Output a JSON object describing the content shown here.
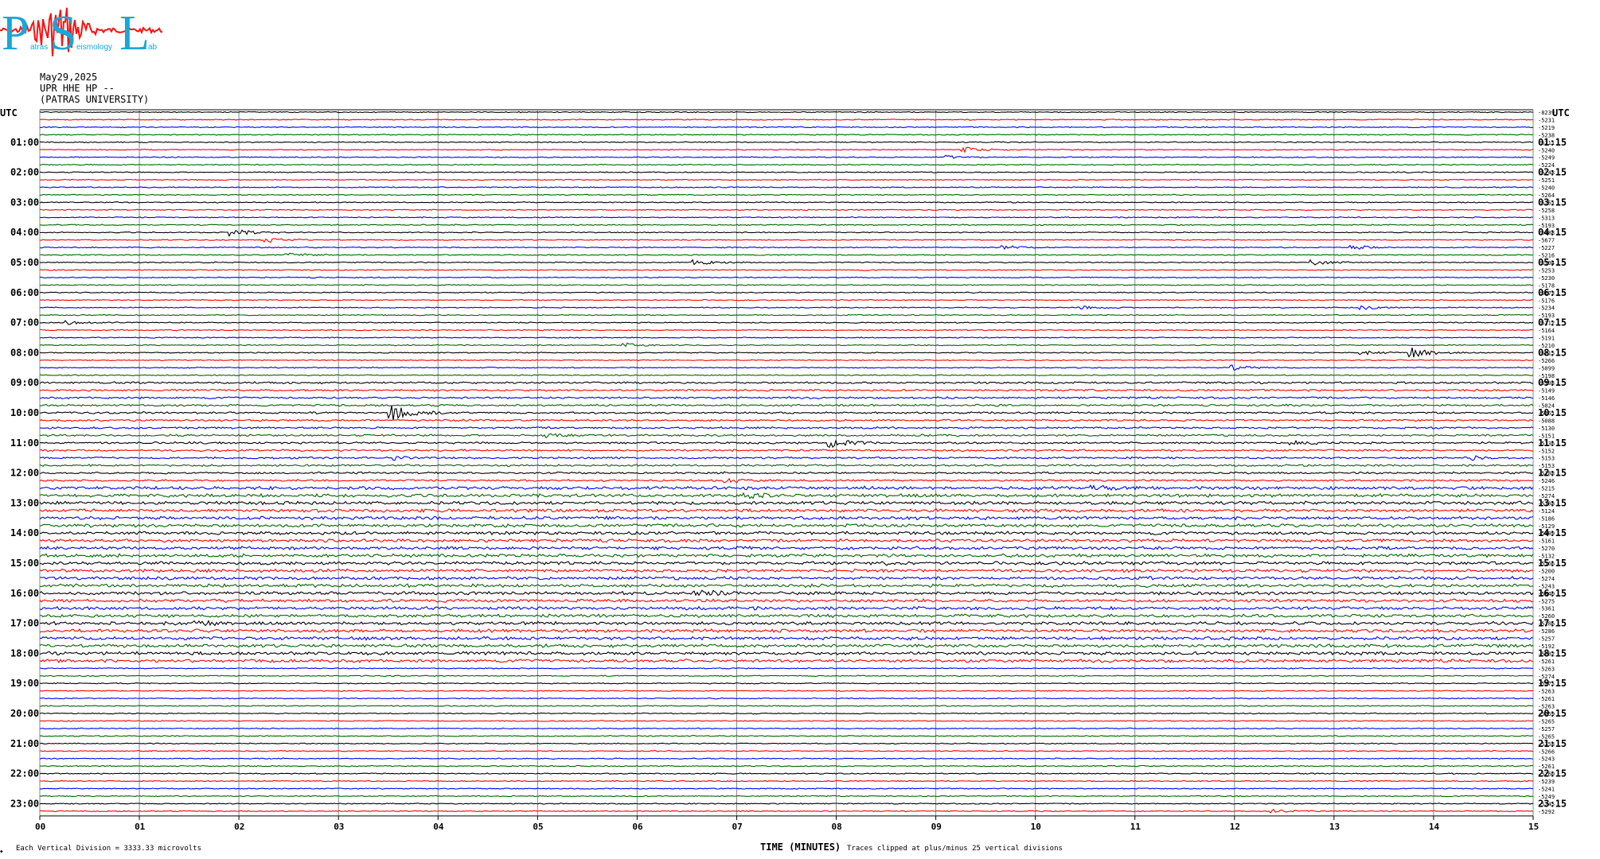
{
  "logo": {
    "letters": [
      "P",
      "S",
      "L"
    ],
    "words": [
      "atras",
      "eismology",
      "ab"
    ],
    "colors": {
      "letters": "#19a6d8",
      "wave": "#ff1010"
    }
  },
  "header": {
    "date": "May29,2025",
    "channel": "UPR HHE HP --",
    "institution": "(PATRAS UNIVERSITY)"
  },
  "footer": {
    "division_note": "Each Vertical Division = 3333.33 microvolts",
    "xlabel": "TIME (MINUTES)",
    "clip_note": "Traces clipped at plus/minus 25 vertical divisions",
    "corner_mark": "◆"
  },
  "chart_data": {
    "type": "line",
    "title": "",
    "xlabel": "TIME (MINUTES)",
    "ylabel": "",
    "xlim": [
      0,
      15
    ],
    "x_ticks": [
      "00",
      "01",
      "02",
      "03",
      "04",
      "05",
      "06",
      "07",
      "08",
      "09",
      "10",
      "11",
      "12",
      "13",
      "14",
      "15"
    ],
    "grid": "vertical lines at each minute",
    "trace_colors": [
      "#000000",
      "#ff0000",
      "#0000ff",
      "#006400"
    ],
    "left_axis_title": "UTC",
    "right_axis_title": "UTC",
    "left_hour_labels": [
      "01:00",
      "02:00",
      "03:00",
      "04:00",
      "05:00",
      "06:00",
      "07:00",
      "08:00",
      "09:00",
      "10:00",
      "11:00",
      "12:00",
      "13:00",
      "14:00",
      "15:00",
      "16:00",
      "17:00",
      "18:00",
      "19:00",
      "20:00",
      "21:00",
      "22:00",
      "23:00"
    ],
    "right_hour_labels": [
      "01:15",
      "02:15",
      "03:15",
      "04:15",
      "05:15",
      "06:15",
      "07:15",
      "08:15",
      "09:15",
      "10:15",
      "11:15",
      "12:15",
      "13:15",
      "14:15",
      "15:15",
      "16:15",
      "17:15",
      "18:15",
      "19:15",
      "20:15",
      "21:15",
      "22:15",
      "23:15"
    ],
    "trace_means": [
      "-8239",
      "-5231",
      "-5219",
      "-5238",
      "-5211",
      "-5240",
      "-5249",
      "-5224",
      "-5248",
      "-5251",
      "-5240",
      "-5264",
      "-5251",
      "-5258",
      "-5313",
      "-5193",
      "-5188",
      "-5677",
      "-5227",
      "-5216",
      "-5194",
      "-5253",
      "-5230",
      "-5178",
      "-5173",
      "-5176",
      "-5234",
      "-5193",
      "-5212",
      "-5164",
      "-5191",
      "-5210",
      "-5215",
      "-5266",
      "-5099",
      "-5198",
      "-5198",
      "-5149",
      "-5146",
      "-5024",
      "-5161",
      "-5088",
      "-5130",
      "-5151",
      "-5136",
      "-5152",
      "-5153",
      "-5153",
      "-5188",
      "-5246",
      "-5215",
      "-5274",
      "-5188",
      "-5124",
      "-5186",
      "-5129",
      "-5199",
      "-5161",
      "-5270",
      "-5132",
      "-5166",
      "-5200",
      "-5274",
      "-5243",
      "-5340",
      "-5275",
      "-5361",
      "-5260",
      "-5286",
      "-5286",
      "-5257",
      "-5192",
      "-5282",
      "-5261",
      "-5263",
      "-5274",
      "-5275",
      "-5263",
      "-5261",
      "-5263",
      "-5259",
      "-5265",
      "-5257",
      "-5265",
      "-5258",
      "-5266",
      "-5243",
      "-5261",
      "-5260",
      "-5239",
      "-5241",
      "-5249",
      "-5245",
      "-5292"
    ],
    "events": [
      {
        "trace": 5,
        "minute": 9.3,
        "amp": 3
      },
      {
        "trace": 6,
        "minute": 9.1,
        "amp": 2
      },
      {
        "trace": 16,
        "minute": 1.95,
        "amp": 4
      },
      {
        "trace": 17,
        "minute": 2.3,
        "amp": 3
      },
      {
        "trace": 18,
        "minute": 9.7,
        "amp": 2.5
      },
      {
        "trace": 18,
        "minute": 13.2,
        "amp": 2.5
      },
      {
        "trace": 19,
        "minute": 2.5,
        "amp": 2
      },
      {
        "trace": 20,
        "minute": 6.6,
        "amp": 3
      },
      {
        "trace": 20,
        "minute": 12.8,
        "amp": 3
      },
      {
        "trace": 26,
        "minute": 10.5,
        "amp": 2
      },
      {
        "trace": 26,
        "minute": 13.3,
        "amp": 2
      },
      {
        "trace": 28,
        "minute": 0.3,
        "amp": 2
      },
      {
        "trace": 31,
        "minute": 5.9,
        "amp": 2
      },
      {
        "trace": 32,
        "minute": 13.8,
        "amp": 6
      },
      {
        "trace": 32,
        "minute": 13.3,
        "amp": 2
      },
      {
        "trace": 34,
        "minute": 12.0,
        "amp": 3
      },
      {
        "trace": 40,
        "minute": 3.55,
        "amp": 9
      },
      {
        "trace": 44,
        "minute": 7.95,
        "amp": 5
      },
      {
        "trace": 44,
        "minute": 12.6,
        "amp": 2
      },
      {
        "trace": 43,
        "minute": 5.1,
        "amp": 2
      },
      {
        "trace": 46,
        "minute": 3.6,
        "amp": 2
      },
      {
        "trace": 46,
        "minute": 14.4,
        "amp": 2
      },
      {
        "trace": 49,
        "minute": 6.9,
        "amp": 2
      },
      {
        "trace": 50,
        "minute": 10.6,
        "amp": 2.5
      },
      {
        "trace": 51,
        "minute": 7.1,
        "amp": 3
      },
      {
        "trace": 60,
        "minute": 8.5,
        "amp": 2
      },
      {
        "trace": 64,
        "minute": 6.6,
        "amp": 4
      },
      {
        "trace": 68,
        "minute": 1.6,
        "amp": 2
      },
      {
        "trace": 93,
        "minute": 12.4,
        "amp": 2
      }
    ]
  }
}
